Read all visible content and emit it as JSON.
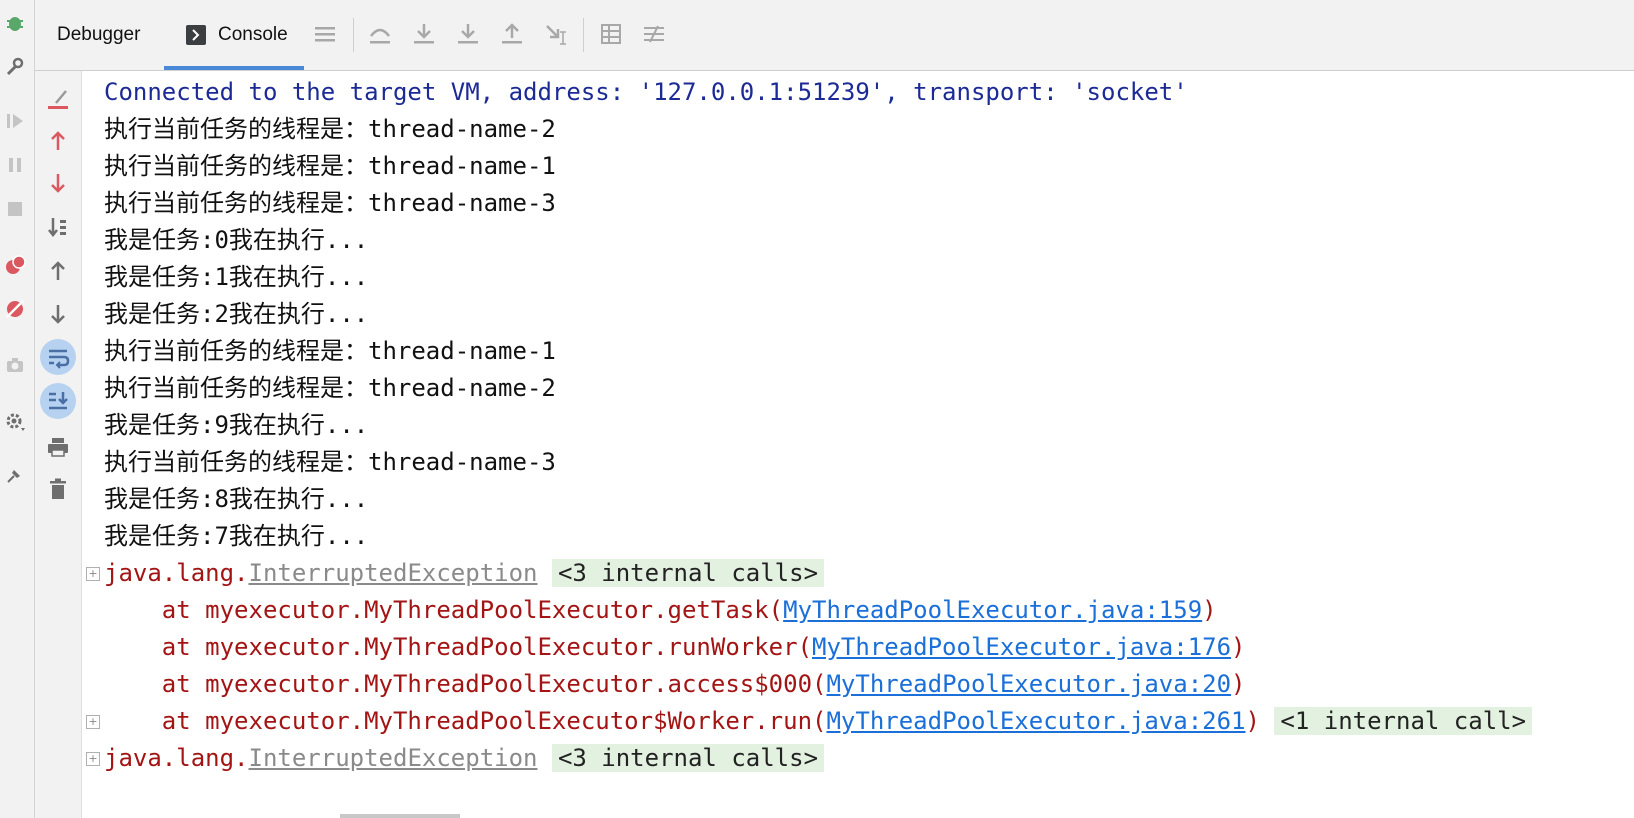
{
  "toolbar": {
    "tabs": [
      {
        "label": "Debugger"
      },
      {
        "label": "Console"
      }
    ],
    "icons": [
      "menu-icon",
      "show-execution-point-icon",
      "step-over-icon",
      "step-into-icon",
      "step-out-icon",
      "run-to-cursor-icon",
      "evaluate-expression-icon",
      "trace-icon"
    ]
  },
  "left_strip": {
    "icons": [
      "bug-icon",
      "wrench-icon",
      "resume-icon",
      "pause-icon",
      "stop-icon",
      "view-breakpoints-icon",
      "mute-breakpoints-icon",
      "camera-icon",
      "settings-icon",
      "pin-icon"
    ]
  },
  "console_side": {
    "icons": [
      "clear-icon",
      "up-red-icon",
      "down-red-icon",
      "sort-icon",
      "up-icon",
      "down-icon",
      "soft-wrap-icon",
      "scroll-to-end-icon",
      "print-icon",
      "trash-icon"
    ]
  },
  "console": {
    "connected": "Connected to the target VM, address: '127.0.0.1:51239', transport: 'socket'",
    "lines": [
      "执行当前任务的线程是：thread-name-2",
      "执行当前任务的线程是：thread-name-1",
      "执行当前任务的线程是：thread-name-3",
      "我是任务:0我在执行...",
      "我是任务:1我在执行...",
      "我是任务:2我在执行...",
      "执行当前任务的线程是：thread-name-1",
      "执行当前任务的线程是：thread-name-2",
      "我是任务:9我在执行...",
      "执行当前任务的线程是：thread-name-3",
      "我是任务:8我在执行...",
      "我是任务:7我在执行..."
    ],
    "exception1": {
      "prefix": "java.lang.",
      "class": "InterruptedException",
      "internal": "<3 internal calls>"
    },
    "stack": [
      {
        "text": "    at myexecutor.MyThreadPoolExecutor.getTask(",
        "link": "MyThreadPoolExecutor.java:159",
        "suffix": ")",
        "internal": ""
      },
      {
        "text": "    at myexecutor.MyThreadPoolExecutor.runWorker(",
        "link": "MyThreadPoolExecutor.java:176",
        "suffix": ")",
        "internal": ""
      },
      {
        "text": "    at myexecutor.MyThreadPoolExecutor.access$000(",
        "link": "MyThreadPoolExecutor.java:20",
        "suffix": ")",
        "internal": ""
      },
      {
        "text": "    at myexecutor.MyThreadPoolExecutor$Worker.run(",
        "link": "MyThreadPoolExecutor.java:261",
        "suffix": ")",
        "internal": "<1 internal call>"
      }
    ],
    "exception2": {
      "prefix": "java.lang.",
      "class": "InterruptedException",
      "internal": "<3 internal calls>"
    }
  },
  "colors": {
    "connected": "#1c2a96",
    "error": "#a31414",
    "link": "#1a6fd8",
    "internal_bg": "#e3f1e0",
    "tab_underline": "#4a88d8"
  }
}
